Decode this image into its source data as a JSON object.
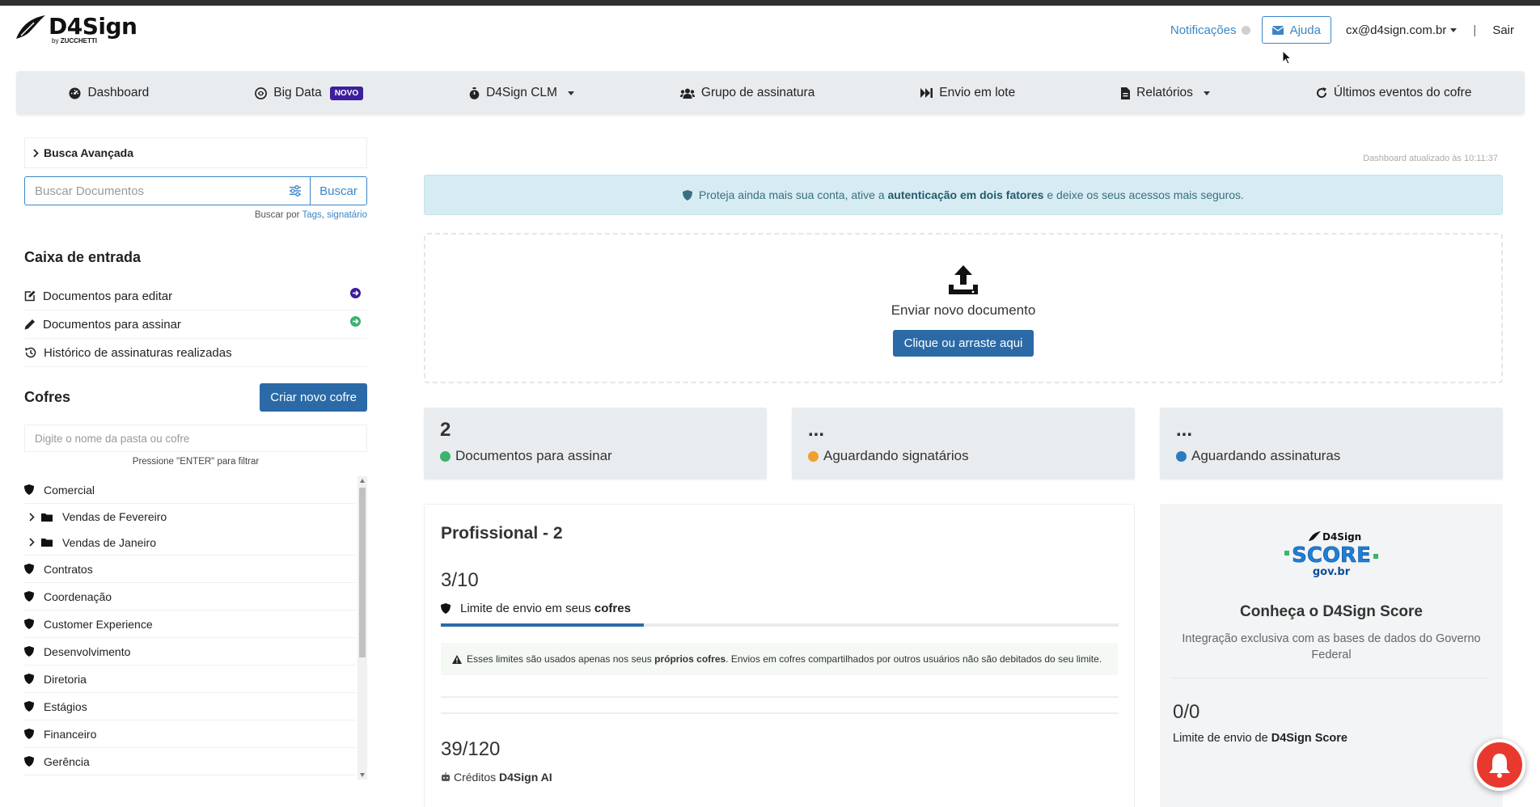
{
  "header": {
    "logo_title": "D4Sign",
    "logo_sub_by": "by",
    "logo_sub_brand": "ZUCCHETTI",
    "notifications_label": "Notificações",
    "help_label": "Ajuda",
    "user_email": "cx@d4sign.com.br",
    "separator": "|",
    "logout_label": "Sair"
  },
  "nav": {
    "items": [
      {
        "label": "Dashboard",
        "icon": "dashboard-icon"
      },
      {
        "label": "Big Data",
        "badge": "NOVO",
        "icon": "big-data-icon"
      },
      {
        "label": "D4Sign CLM",
        "icon": "clm-icon"
      },
      {
        "label": "Grupo de assinatura",
        "icon": "users-icon"
      },
      {
        "label": "Envio em lote",
        "icon": "fast-forward-icon"
      },
      {
        "label": "Relatórios",
        "icon": "file-report-icon"
      },
      {
        "label": "Últimos eventos do cofre",
        "icon": "refresh-icon"
      }
    ]
  },
  "sidebar": {
    "advanced_search": "Busca Avançada",
    "search_placeholder": "Buscar Documentos",
    "search_button": "Buscar",
    "search_hint_prefix": "Buscar por",
    "search_hint_tags": "Tags",
    "search_hint_signer": "signatário",
    "inbox_title": "Caixa de entrada",
    "inbox_items": [
      {
        "label": "Documentos para editar"
      },
      {
        "label": "Documentos para assinar"
      },
      {
        "label": "Histórico de assinaturas realizadas"
      }
    ],
    "cofres_title": "Cofres",
    "new_cofre_button": "Criar novo cofre",
    "filter_placeholder": "Digite o nome da pasta ou cofre",
    "filter_hint": "Pressione \"ENTER\" para filtrar",
    "cofres": [
      {
        "label": "Comercial",
        "type": "cofre"
      },
      {
        "label": "Vendas de Fevereiro",
        "type": "folder"
      },
      {
        "label": "Vendas de Janeiro",
        "type": "folder"
      },
      {
        "label": "Contratos",
        "type": "cofre"
      },
      {
        "label": "Coordenação",
        "type": "cofre"
      },
      {
        "label": "Customer Experience",
        "type": "cofre"
      },
      {
        "label": "Desenvolvimento",
        "type": "cofre"
      },
      {
        "label": "Diretoria",
        "type": "cofre"
      },
      {
        "label": "Estágios",
        "type": "cofre"
      },
      {
        "label": "Financeiro",
        "type": "cofre"
      },
      {
        "label": "Gerência",
        "type": "cofre"
      }
    ]
  },
  "main": {
    "updated_text": "Dashboard atualizado às 10:11:37",
    "alert_prefix": "Proteja ainda mais sua conta, ative a",
    "alert_bold": "autenticação em dois fatores",
    "alert_suffix": "e deixe os seus acessos mais seguros.",
    "upload_title": "Enviar novo documento",
    "upload_button": "Clique ou arraste aqui",
    "stats": [
      {
        "value": "2",
        "label": "Documentos para assinar",
        "color": "#3cb371"
      },
      {
        "value": "...",
        "label": "Aguardando signatários",
        "color": "#f0a030"
      },
      {
        "value": "...",
        "label": "Aguardando assinaturas",
        "color": "#2b7bbf"
      }
    ],
    "plan": {
      "title": "Profissional - 2",
      "usage": "3/10",
      "usage_fraction": 0.3,
      "limit_prefix": "Limite de envio em seus",
      "limit_bold": "cofres",
      "warning_prefix": "Esses limites são usados apenas nos seus",
      "warning_bold": "próprios cofres",
      "warning_suffix": ". Envios em cofres compartilhados por outros usuários não são debitados do seu limite.",
      "ai_usage": "39/120",
      "ai_label_prefix": "Créditos",
      "ai_label_bold": "D4Sign AI"
    },
    "score": {
      "logo_brand": "D4Sign",
      "logo_word": "SCORE",
      "logo_gov": "gov.br",
      "title": "Conheça o D4Sign Score",
      "description": "Integração exclusiva com as bases de dados do Governo Federal",
      "usage": "0/0",
      "limit_prefix": "Limite de envio de",
      "limit_bold": "D4Sign Score"
    }
  },
  "colors": {
    "primary": "#2b6aa7",
    "link": "#3b86c8",
    "nav_bg": "#e9ecef",
    "novo_badge": "#3c1e9e",
    "alert_bg": "#d6ecf2",
    "fab": "#e8392f"
  }
}
